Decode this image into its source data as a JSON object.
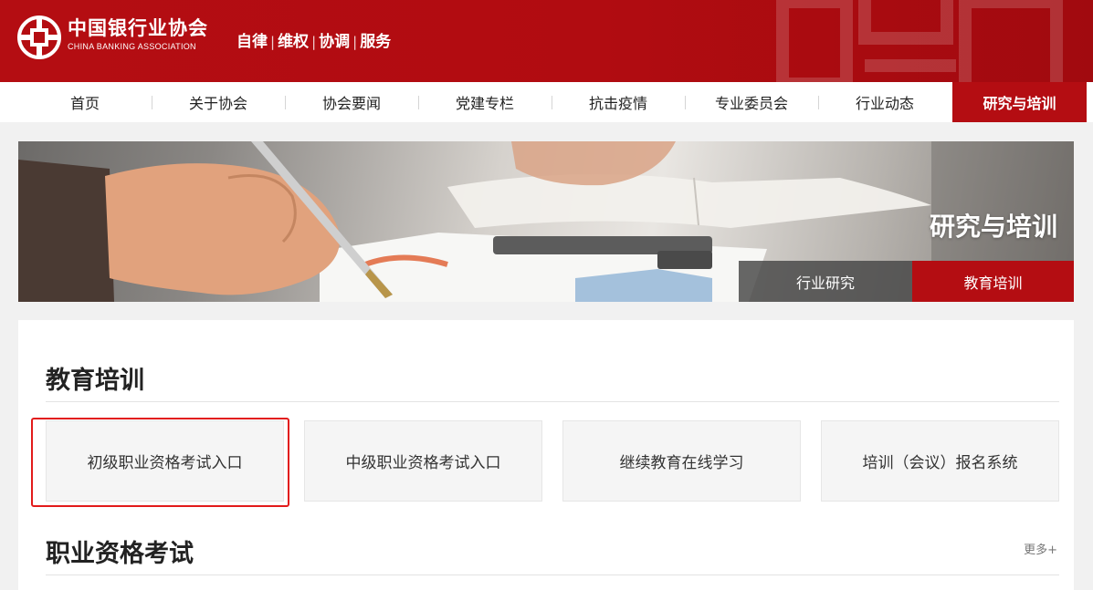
{
  "header": {
    "logo_cn": "中国银行业协会",
    "logo_en": "CHINA BANKING ASSOCIATION",
    "slogan": [
      "自律",
      "维权",
      "协调",
      "服务"
    ],
    "brand_color": "#b40d12"
  },
  "nav": {
    "items": [
      {
        "label": "首页"
      },
      {
        "label": "关于协会"
      },
      {
        "label": "协会要闻"
      },
      {
        "label": "党建专栏"
      },
      {
        "label": "抗击疫情"
      },
      {
        "label": "专业委员会"
      },
      {
        "label": "行业动态"
      },
      {
        "label": "研究与培训",
        "active": true
      }
    ]
  },
  "banner": {
    "title": "研究与培训",
    "tabs": [
      {
        "label": "行业研究"
      },
      {
        "label": "教育培训",
        "active": true
      }
    ]
  },
  "education": {
    "title": "教育培训",
    "entries": [
      {
        "label": "初级职业资格考试入口",
        "highlighted": true
      },
      {
        "label": "中级职业资格考试入口"
      },
      {
        "label": "继续教育在线学习"
      },
      {
        "label": "培训（会议）报名系统"
      }
    ]
  },
  "qualification": {
    "title": "职业资格考试",
    "more_label": "更多+"
  },
  "colors": {
    "accent": "#b40d12",
    "highlight_border": "#e21b1b"
  }
}
